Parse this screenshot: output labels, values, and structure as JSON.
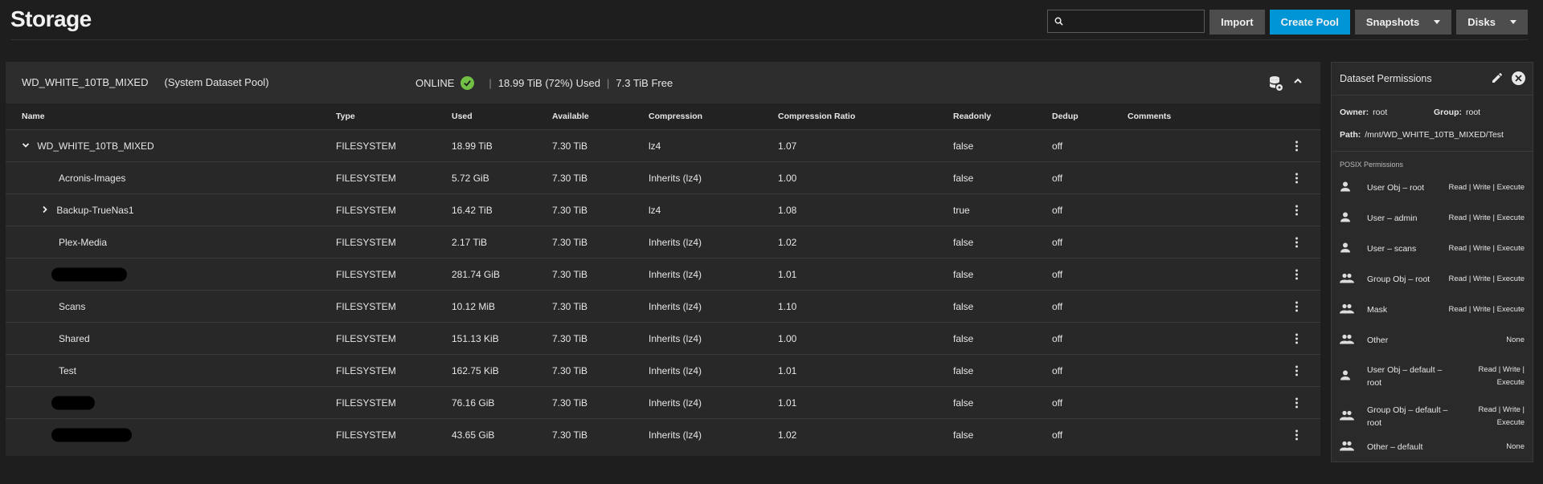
{
  "page": {
    "title": "Storage"
  },
  "toolbar": {
    "search_placeholder": "",
    "import_label": "Import",
    "create_pool_label": "Create Pool",
    "snapshots_label": "Snapshots",
    "disks_label": "Disks",
    "accent_color": "#0095d5"
  },
  "pool": {
    "name": "WD_WHITE_10TB_MIXED",
    "system_dataset": "(System Dataset Pool)",
    "status": "ONLINE",
    "used": "18.99 TiB (72%) Used",
    "free": "7.3 TiB Free",
    "status_color": "#71bf44"
  },
  "grid": {
    "columns": [
      "Name",
      "Type",
      "Used",
      "Available",
      "Compression",
      "Compression Ratio",
      "Readonly",
      "Dedup",
      "Comments"
    ],
    "rows": [
      {
        "name": "WD_WHITE_10TB_MIXED",
        "type": "FILESYSTEM",
        "used": "18.99 TiB",
        "available": "7.30 TiB",
        "compression": "lz4",
        "ratio": "1.07",
        "readonly": "false",
        "dedup": "off",
        "comments": ""
      },
      {
        "name": "Acronis-Images",
        "type": "FILESYSTEM",
        "used": "5.72 GiB",
        "available": "7.30 TiB",
        "compression": "Inherits (lz4)",
        "ratio": "1.00",
        "readonly": "false",
        "dedup": "off",
        "comments": ""
      },
      {
        "name": "Backup-TrueNas1",
        "type": "FILESYSTEM",
        "used": "16.42 TiB",
        "available": "7.30 TiB",
        "compression": "lz4",
        "ratio": "1.08",
        "readonly": "true",
        "dedup": "off",
        "comments": ""
      },
      {
        "name": "Plex-Media",
        "type": "FILESYSTEM",
        "used": "2.17 TiB",
        "available": "7.30 TiB",
        "compression": "Inherits (lz4)",
        "ratio": "1.02",
        "readonly": "false",
        "dedup": "off",
        "comments": ""
      },
      {
        "name": "",
        "type": "FILESYSTEM",
        "used": "281.74 GiB",
        "available": "7.30 TiB",
        "compression": "Inherits (lz4)",
        "ratio": "1.01",
        "readonly": "false",
        "dedup": "off",
        "comments": ""
      },
      {
        "name": "Scans",
        "type": "FILESYSTEM",
        "used": "10.12 MiB",
        "available": "7.30 TiB",
        "compression": "Inherits (lz4)",
        "ratio": "1.10",
        "readonly": "false",
        "dedup": "off",
        "comments": ""
      },
      {
        "name": "Shared",
        "type": "FILESYSTEM",
        "used": "151.13 KiB",
        "available": "7.30 TiB",
        "compression": "Inherits (lz4)",
        "ratio": "1.00",
        "readonly": "false",
        "dedup": "off",
        "comments": ""
      },
      {
        "name": "Test",
        "type": "FILESYSTEM",
        "used": "162.75 KiB",
        "available": "7.30 TiB",
        "compression": "Inherits (lz4)",
        "ratio": "1.01",
        "readonly": "false",
        "dedup": "off",
        "comments": ""
      },
      {
        "name": "",
        "type": "FILESYSTEM",
        "used": "76.16 GiB",
        "available": "7.30 TiB",
        "compression": "Inherits (lz4)",
        "ratio": "1.01",
        "readonly": "false",
        "dedup": "off",
        "comments": ""
      },
      {
        "name": "",
        "type": "FILESYSTEM",
        "used": "43.65 GiB",
        "available": "7.30 TiB",
        "compression": "Inherits (lz4)",
        "ratio": "1.02",
        "readonly": "false",
        "dedup": "off",
        "comments": ""
      }
    ]
  },
  "permissions": {
    "title": "Dataset Permissions",
    "owner_label": "Owner:",
    "owner": "root",
    "group_label": "Group:",
    "group": "root",
    "path_label": "Path:",
    "path": "/mnt/WD_WHITE_10TB_MIXED/Test",
    "posix_title": "POSIX Permissions",
    "entries": [
      {
        "icon": "user-icon",
        "label": "User Obj – root",
        "perms": "Read | Write | Execute"
      },
      {
        "icon": "user-icon",
        "label": "User – admin",
        "perms": "Read | Write | Execute"
      },
      {
        "icon": "user-icon",
        "label": "User – scans",
        "perms": "Read | Write | Execute"
      },
      {
        "icon": "group-icon",
        "label": "Group Obj – root",
        "perms": "Read | Write | Execute"
      },
      {
        "icon": "group-icon",
        "label": "Mask",
        "perms": "Read | Write | Execute"
      },
      {
        "icon": "group-icon",
        "label": "Other",
        "perms": "None"
      },
      {
        "icon": "user-icon",
        "label": "User Obj – default – root",
        "perms": "Read | Write | Execute"
      },
      {
        "icon": "group-icon",
        "label": "Group Obj – default – root",
        "perms": "Read | Write | Execute"
      },
      {
        "icon": "group-icon",
        "label": "Other – default",
        "perms": "None"
      }
    ]
  }
}
